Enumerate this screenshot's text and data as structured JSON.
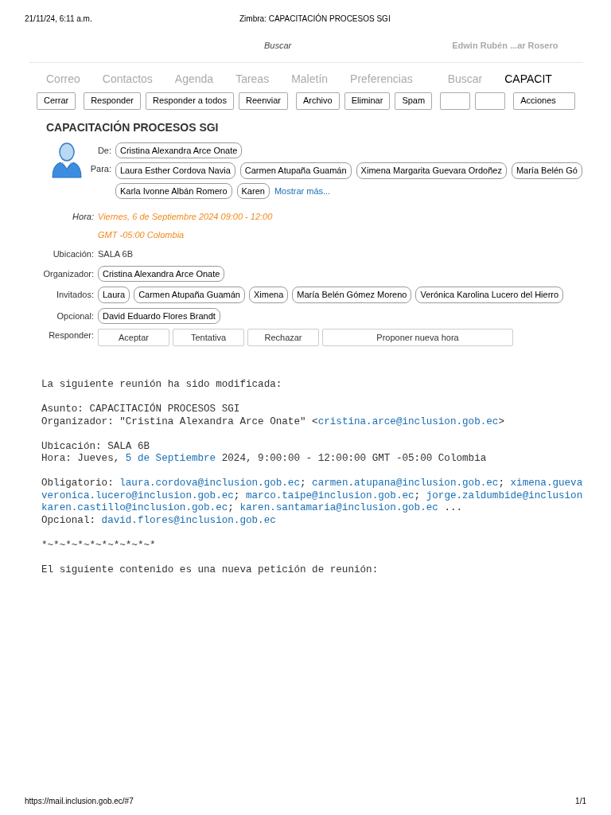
{
  "print_header": {
    "date": "21/11/24, 6:11 a.m.",
    "title": "Zimbra: CAPACITACIÓN PROCESOS SGI"
  },
  "top_bar": {
    "search": "Buscar",
    "user": "Edwin Rubén ...ar Rosero"
  },
  "tabs": [
    {
      "label": "Correo",
      "selected": false
    },
    {
      "label": "Contactos",
      "selected": false
    },
    {
      "label": "Agenda",
      "selected": false
    },
    {
      "label": "Tareas",
      "selected": false
    },
    {
      "label": "Maletín",
      "selected": false
    },
    {
      "label": "Preferencias",
      "selected": false
    },
    {
      "label": "Buscar",
      "selected": false
    },
    {
      "label": "CAPACIT",
      "selected": true
    }
  ],
  "toolbar": [
    {
      "kind": "button",
      "label": "Cerrar"
    },
    {
      "kind": "button",
      "label": "Responder"
    },
    {
      "kind": "button",
      "label": "Responder a todos"
    },
    {
      "kind": "button",
      "label": "Reenviar"
    },
    {
      "kind": "button",
      "label": "Archivo"
    },
    {
      "kind": "button",
      "label": "Eliminar"
    },
    {
      "kind": "button",
      "label": "Spam"
    },
    {
      "kind": "blank"
    },
    {
      "kind": "blank"
    },
    {
      "kind": "menu",
      "label": "Acciones"
    }
  ],
  "message": {
    "subject": "CAPACITACIÓN PROCESOS SGI",
    "from": {
      "label": "De:",
      "people": [
        "Cristina Alexandra Arce Onate"
      ]
    },
    "to": {
      "label": "Para:",
      "people": [
        "Laura Esther Cordova Navia",
        "Carmen Atupaña Guamán",
        "Ximena Margarita Guevara Ordoñez",
        "María Belén Gó",
        "Karla Ivonne Albán Romero",
        "Karen"
      ],
      "more": "Mostrar más..."
    },
    "time": {
      "label": "Hora:",
      "lines": [
        "Viernes, 6 de Septiembre 2024 09:00 - 12:00",
        "GMT -05:00 Colombia"
      ]
    },
    "fields": [
      {
        "label": "Ubicación:",
        "kind": "text",
        "value": "SALA 6B"
      },
      {
        "label": "Organizador:",
        "kind": "people",
        "people": [
          "Cristina Alexandra Arce Onate"
        ]
      },
      {
        "label": "Invitados:",
        "kind": "people",
        "people": [
          "Laura",
          "Carmen Atupaña Guamán",
          "Ximena",
          "María Belén Gómez Moreno",
          "Verónica Karolina Lucero del Hierro"
        ]
      },
      {
        "label": "Opcional:",
        "kind": "people",
        "people": [
          "David Eduardo Flores Brandt"
        ]
      }
    ],
    "respond": {
      "label": "Responder:",
      "buttons": [
        "Aceptar",
        "Tentativa",
        "Rechazar",
        "Proponer nueva hora"
      ]
    }
  },
  "body": [
    [
      [
        {
          "kind": "text",
          "text": "La siguiente reunión ha sido modificada:"
        }
      ]
    ],
    [
      [
        {
          "kind": "text",
          "text": "Asunto: CAPACITACIÓN PROCESOS SGI"
        }
      ],
      [
        {
          "kind": "text",
          "text": "Organizador: \"Cristina Alexandra Arce Onate\" <"
        },
        {
          "kind": "link",
          "text": "cristina.arce@inclusion.gob.ec"
        },
        {
          "kind": "text",
          "text": ">"
        }
      ]
    ],
    [
      [
        {
          "kind": "text",
          "text": "Ubicación: SALA 6B"
        }
      ],
      [
        {
          "kind": "text",
          "text": "Hora: Jueves, "
        },
        {
          "kind": "link",
          "text": "5 de Septiembre"
        },
        {
          "kind": "text",
          "text": " 2024, 9:00:00 - 12:00:00 GMT -05:00 Colombia"
        }
      ]
    ],
    [
      [
        {
          "kind": "text",
          "text": "Obligatorio: "
        },
        {
          "kind": "link",
          "text": "laura.cordova@inclusion.gob.ec"
        },
        {
          "kind": "text",
          "text": "; "
        },
        {
          "kind": "link",
          "text": "carmen.atupana@inclusion.gob.ec"
        },
        {
          "kind": "text",
          "text": "; "
        },
        {
          "kind": "link",
          "text": "ximena.gueva"
        }
      ],
      [
        {
          "kind": "link",
          "text": "veronica.lucero@inclusion.gob.ec"
        },
        {
          "kind": "text",
          "text": "; "
        },
        {
          "kind": "link",
          "text": "marco.taipe@inclusion.gob.ec"
        },
        {
          "kind": "text",
          "text": "; "
        },
        {
          "kind": "link",
          "text": "jorge.zaldumbide@inclusion"
        }
      ],
      [
        {
          "kind": "link",
          "text": "karen.castillo@inclusion.gob.ec"
        },
        {
          "kind": "text",
          "text": "; "
        },
        {
          "kind": "link",
          "text": "karen.santamaria@inclusion.gob.ec"
        },
        {
          "kind": "text",
          "text": " ..."
        }
      ],
      [
        {
          "kind": "text",
          "text": "Opcional: "
        },
        {
          "kind": "link",
          "text": "david.flores@inclusion.gob.ec"
        }
      ]
    ],
    [
      [
        {
          "kind": "text",
          "text": "*~*~*~*~*~*~*~*~*~*"
        }
      ]
    ],
    [
      [
        {
          "kind": "text",
          "text": "El siguiente contenido es una nueva petición de reunión:"
        }
      ]
    ]
  ],
  "print_footer": {
    "url": "https://mail.inclusion.gob.ec/#7",
    "page": "1/1"
  }
}
